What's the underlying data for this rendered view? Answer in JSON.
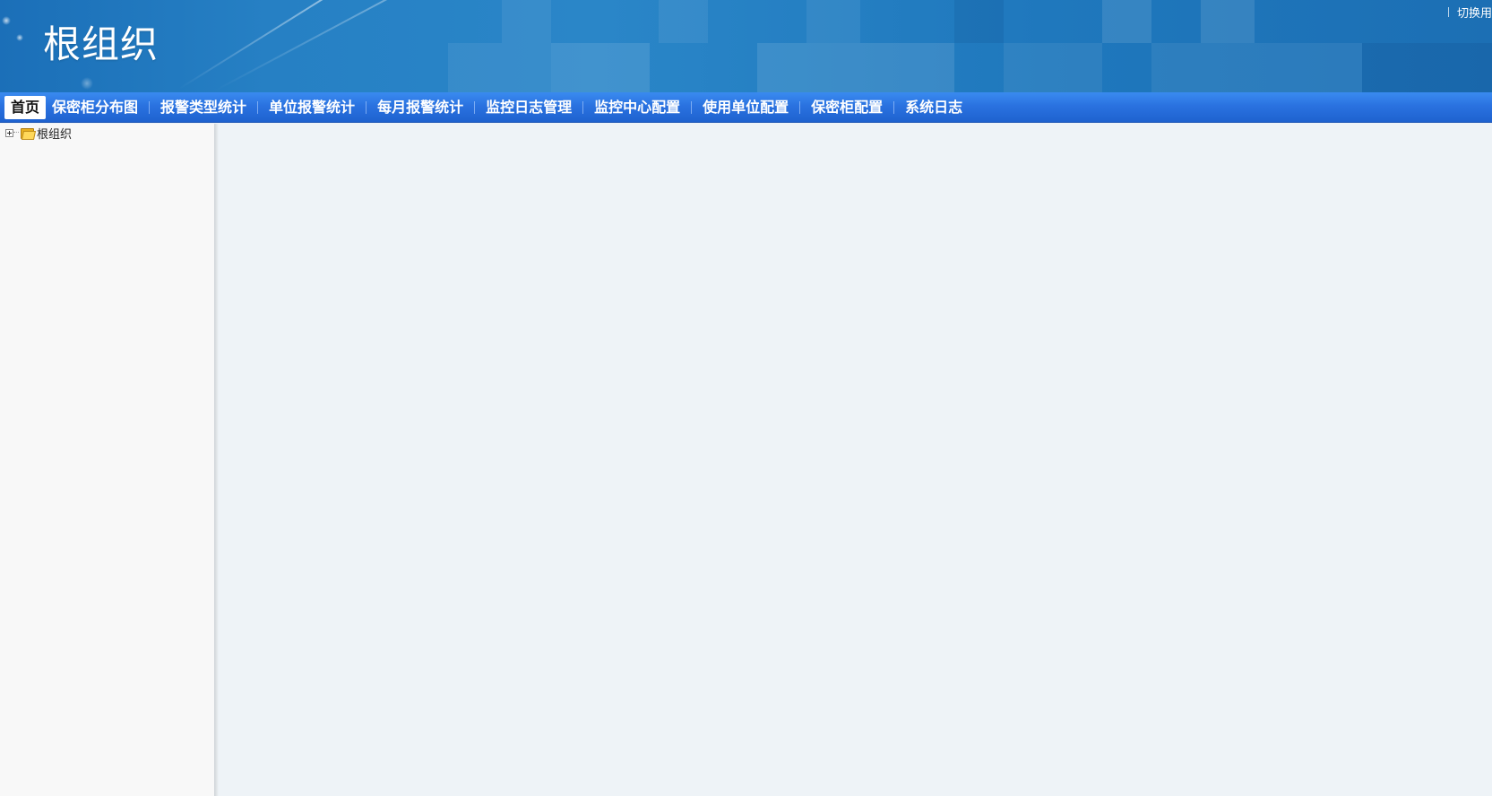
{
  "header": {
    "title": "根组织",
    "top_right_link": "切换用"
  },
  "nav": {
    "items": [
      {
        "label": "首页",
        "active": true
      },
      {
        "label": "保密柜分布图",
        "active": false
      },
      {
        "label": "报警类型统计",
        "active": false
      },
      {
        "label": "单位报警统计",
        "active": false
      },
      {
        "label": "每月报警统计",
        "active": false
      },
      {
        "label": "监控日志管理",
        "active": false
      },
      {
        "label": "监控中心配置",
        "active": false
      },
      {
        "label": "使用单位配置",
        "active": false
      },
      {
        "label": "保密柜配置",
        "active": false
      },
      {
        "label": "系统日志",
        "active": false
      }
    ]
  },
  "sidebar": {
    "tree": [
      {
        "label": "根组织",
        "icon": "folder-icon",
        "expanded": false
      }
    ]
  },
  "colors": {
    "banner": "#2680c4",
    "navbar": "#2a72e0",
    "sidebar_bg": "#f8f8f8",
    "main_bg": "#eef3f7"
  }
}
